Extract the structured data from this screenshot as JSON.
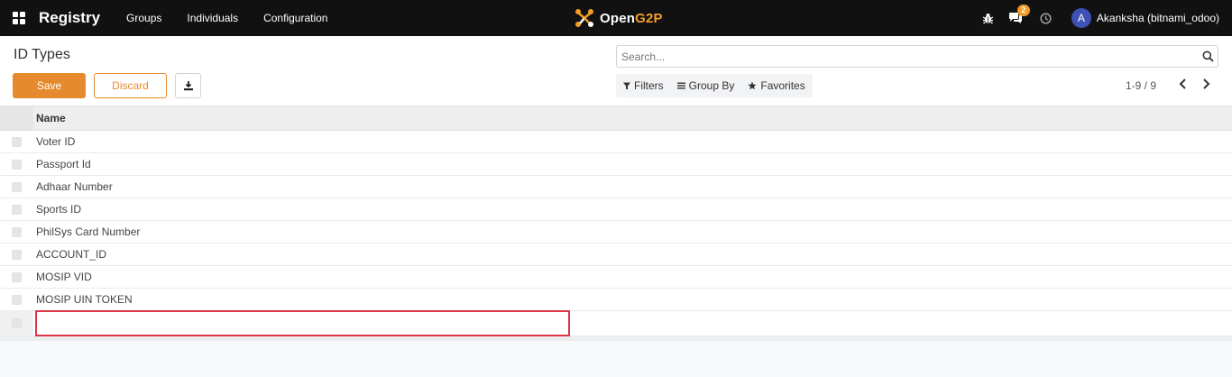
{
  "navbar": {
    "brand": "Registry",
    "menu": [
      "Groups",
      "Individuals",
      "Configuration"
    ],
    "logo_text_main": "Open",
    "logo_text_accent": "G2P",
    "chat_badge": "2",
    "avatar_letter": "A",
    "username": "Akanksha (bitnami_odoo)",
    "accent_color": "#f39c26"
  },
  "control": {
    "title": "ID Types",
    "save_label": "Save",
    "discard_label": "Discard",
    "search_placeholder": "Search...",
    "filters_label": "Filters",
    "groupby_label": "Group By",
    "favorites_label": "Favorites",
    "pager": "1-9 / 9",
    "primary_color": "#e68a2e"
  },
  "table": {
    "column_name": "Name",
    "rows": [
      "Voter ID",
      "Passport Id",
      "Adhaar Number",
      "Sports ID",
      "PhilSys Card Number",
      "ACCOUNT_ID",
      "MOSIP VID",
      "MOSIP UIN TOKEN"
    ],
    "edit_value": "",
    "edit_border_color": "#dc3545"
  }
}
